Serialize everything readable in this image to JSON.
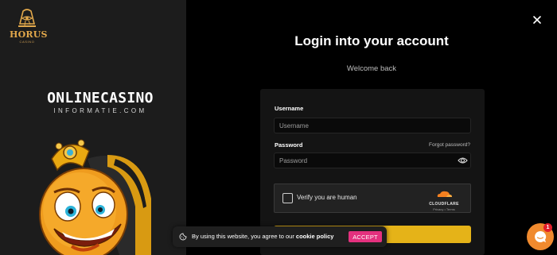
{
  "brand": {
    "name": "HORUS",
    "subtitle": "CASINO",
    "color": "#e2a84b"
  },
  "partner_logo": {
    "title": "onlinecasino",
    "subtitle": "INFORMATIE.COM"
  },
  "header": {
    "close_icon": "close-icon"
  },
  "login": {
    "title": "Login into your account",
    "welcome": "Welcome back",
    "username_label": "Username",
    "username_placeholder": "Username",
    "username_value": "",
    "password_label": "Password",
    "password_placeholder": "Password",
    "password_value": "",
    "forgot_password": "Forgot password?",
    "show_password_icon": "eye-icon",
    "login_button_label": "",
    "login_button_color": "#e5b318"
  },
  "captcha": {
    "label": "Verify you are human",
    "provider": "CLOUDFLARE",
    "links": "Privacy  •  Terms",
    "checked": false
  },
  "cookie_banner": {
    "text_before": "By using this website, you agree to our ",
    "link": "cookie policy",
    "accept_label": "ACCEPT",
    "accept_color": "#e4317e"
  },
  "chat": {
    "badge_count": "1",
    "icon": "chat-bubble-icon",
    "color": "#f08a2e"
  }
}
